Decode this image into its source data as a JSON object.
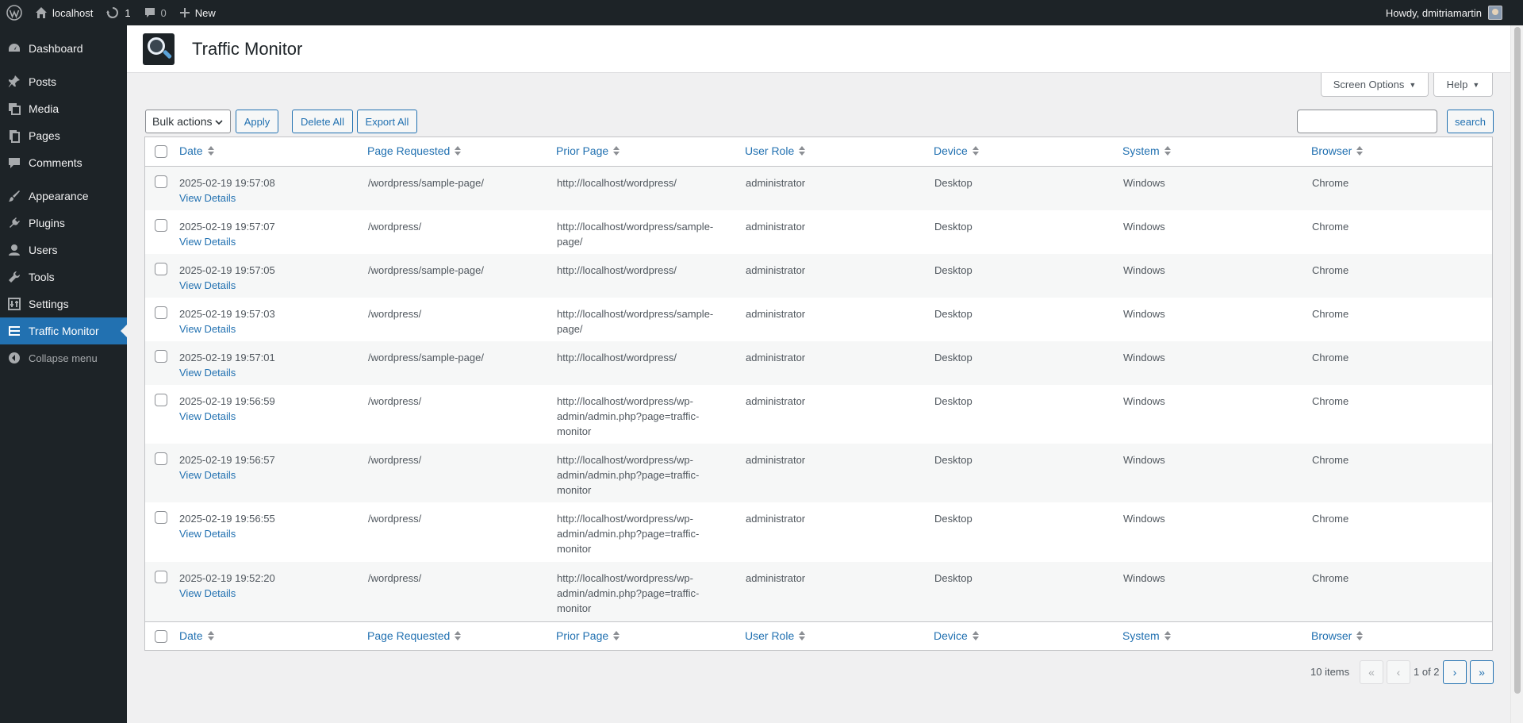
{
  "adminbar": {
    "site_name": "localhost",
    "updates_count": "1",
    "comments_count": "0",
    "new_label": "New",
    "howdy": "Howdy, dmitriamartin"
  },
  "sidebar": {
    "items": [
      {
        "label": "Dashboard",
        "icon": "dashboard-icon"
      },
      {
        "label": "Posts",
        "icon": "pushpin-icon"
      },
      {
        "label": "Media",
        "icon": "media-icon"
      },
      {
        "label": "Pages",
        "icon": "pages-icon"
      },
      {
        "label": "Comments",
        "icon": "comment-icon"
      },
      {
        "label": "Appearance",
        "icon": "brush-icon"
      },
      {
        "label": "Plugins",
        "icon": "plug-icon"
      },
      {
        "label": "Users",
        "icon": "user-icon"
      },
      {
        "label": "Tools",
        "icon": "wrench-icon"
      },
      {
        "label": "Settings",
        "icon": "settings-icon"
      },
      {
        "label": "Traffic Monitor",
        "icon": "list-icon"
      }
    ],
    "collapse_label": "Collapse menu",
    "current_color": "#2271b1"
  },
  "page": {
    "title": "Traffic Monitor"
  },
  "screen_meta": {
    "screen_options": "Screen Options",
    "help": "Help"
  },
  "toolbar": {
    "bulk_actions": "Bulk actions",
    "apply": "Apply",
    "delete_all": "Delete All",
    "export_all": "Export All",
    "search_button": "search",
    "search_value": ""
  },
  "table": {
    "columns": [
      "Date",
      "Page Requested",
      "Prior Page",
      "User Role",
      "Device",
      "System",
      "Browser"
    ],
    "view_details_label": "View Details",
    "rows": [
      {
        "date": "2025-02-19 19:57:08",
        "page": "/wordpress/sample-page/",
        "prior": [
          "http://localhost/wordpress/"
        ],
        "role": "administrator",
        "device": "Desktop",
        "system": "Windows",
        "browser": "Chrome"
      },
      {
        "date": "2025-02-19 19:57:07",
        "page": "/wordpress/",
        "prior": [
          "http://localhost/wordpress/sample-",
          "page/"
        ],
        "role": "administrator",
        "device": "Desktop",
        "system": "Windows",
        "browser": "Chrome"
      },
      {
        "date": "2025-02-19 19:57:05",
        "page": "/wordpress/sample-page/",
        "prior": [
          "http://localhost/wordpress/"
        ],
        "role": "administrator",
        "device": "Desktop",
        "system": "Windows",
        "browser": "Chrome"
      },
      {
        "date": "2025-02-19 19:57:03",
        "page": "/wordpress/",
        "prior": [
          "http://localhost/wordpress/sample-",
          "page/"
        ],
        "role": "administrator",
        "device": "Desktop",
        "system": "Windows",
        "browser": "Chrome"
      },
      {
        "date": "2025-02-19 19:57:01",
        "page": "/wordpress/sample-page/",
        "prior": [
          "http://localhost/wordpress/"
        ],
        "role": "administrator",
        "device": "Desktop",
        "system": "Windows",
        "browser": "Chrome"
      },
      {
        "date": "2025-02-19 19:56:59",
        "page": "/wordpress/",
        "prior": [
          "http://localhost/wordpress/wp-",
          "admin/admin.php?page=traffic-",
          "monitor"
        ],
        "role": "administrator",
        "device": "Desktop",
        "system": "Windows",
        "browser": "Chrome"
      },
      {
        "date": "2025-02-19 19:56:57",
        "page": "/wordpress/",
        "prior": [
          "http://localhost/wordpress/wp-",
          "admin/admin.php?page=traffic-",
          "monitor"
        ],
        "role": "administrator",
        "device": "Desktop",
        "system": "Windows",
        "browser": "Chrome"
      },
      {
        "date": "2025-02-19 19:56:55",
        "page": "/wordpress/",
        "prior": [
          "http://localhost/wordpress/wp-",
          "admin/admin.php?page=traffic-",
          "monitor"
        ],
        "role": "administrator",
        "device": "Desktop",
        "system": "Windows",
        "browser": "Chrome"
      },
      {
        "date": "2025-02-19 19:52:20",
        "page": "/wordpress/",
        "prior": [
          "http://localhost/wordpress/wp-",
          "admin/admin.php?page=traffic-",
          "monitor"
        ],
        "role": "administrator",
        "device": "Desktop",
        "system": "Windows",
        "browser": "Chrome"
      }
    ]
  },
  "pagination": {
    "items_count": "10 items",
    "first": "«",
    "prev": "‹",
    "page_text": "1 of 2",
    "next": "›",
    "last": "»"
  }
}
